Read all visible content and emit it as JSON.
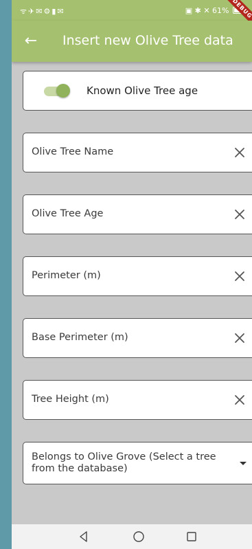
{
  "status_bar": {
    "left_icons": "ᯤ✈✉⚙▮✉",
    "right_icons": "▣ ✱ ✕",
    "battery": "61%",
    "debug_banner": "DEBUG"
  },
  "app_bar": {
    "back_icon": "arrow-left-icon",
    "back_glyph": "←",
    "title": "Insert new Olive Tree data"
  },
  "toggle": {
    "label": "Known Olive Tree age",
    "checked": true,
    "accent_color": "#8fb25a"
  },
  "fields": [
    {
      "label": "Olive Tree Name",
      "clear_icon": "close-icon"
    },
    {
      "label": "Olive Tree Age",
      "clear_icon": "close-icon"
    },
    {
      "label": "Perimeter (m)",
      "clear_icon": "close-icon"
    },
    {
      "label": "Base Perimeter (m)",
      "clear_icon": "close-icon"
    },
    {
      "label": "Tree Height (m)",
      "clear_icon": "close-icon"
    }
  ],
  "dropdown": {
    "label": "Belongs to Olive Grove (Select a tree from the database)",
    "icon": "caret-down-icon"
  },
  "nav_bar": {
    "back_icon": "triangle-back-icon",
    "home_icon": "circle-home-icon",
    "recents_icon": "square-recents-icon"
  },
  "colors": {
    "app_bar": "#a5c06e",
    "background": "#c9c9c9",
    "card": "#ffffff"
  }
}
